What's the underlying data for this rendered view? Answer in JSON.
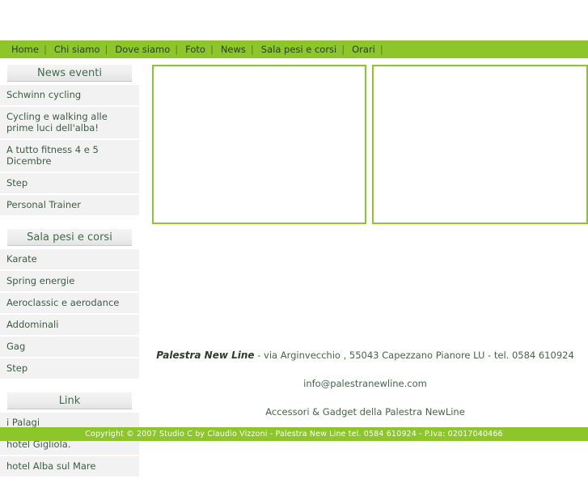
{
  "nav": {
    "separator": "|",
    "items": [
      {
        "label": "Home"
      },
      {
        "label": "Chi siamo"
      },
      {
        "label": "Dove siamo"
      },
      {
        "label": "Foto"
      },
      {
        "label": "News"
      },
      {
        "label": "Sala pesi e corsi"
      },
      {
        "label": "Orari"
      }
    ]
  },
  "sidebar": {
    "panels": [
      {
        "title": "News eventi",
        "items": [
          {
            "label": "Schwinn cycling"
          },
          {
            "label": "Cycling e walking alle prime luci dell'alba!"
          },
          {
            "label": "A tutto fitness 4 e 5 Dicembre"
          },
          {
            "label": "Step"
          },
          {
            "label": "Personal Trainer"
          }
        ]
      },
      {
        "title": "Sala pesi e corsi",
        "items": [
          {
            "label": "Karate"
          },
          {
            "label": "Spring energie"
          },
          {
            "label": "Aeroclassic e aerodance"
          },
          {
            "label": "Addominali"
          },
          {
            "label": "Gag"
          },
          {
            "label": "Step"
          }
        ]
      },
      {
        "title": "Link",
        "items": [
          {
            "label": "i Palagi"
          },
          {
            "label": "hotel Gigliola."
          },
          {
            "label": "hotel Alba sul Mare"
          }
        ]
      }
    ]
  },
  "main": {
    "media_boxes": [
      {
        "name": "media-placeholder-left"
      },
      {
        "name": "media-placeholder-right"
      }
    ],
    "contact": {
      "business_name": "Palestra New Line",
      "address_line": " - via Arginvecchio , 55043 Capezzano Pianore LU - tel. 0584 610924",
      "email": "info@palestranewline.com",
      "tagline": "Accessori & Gadget della Palestra NewLine"
    }
  },
  "footer": {
    "copyright": "Copyright © 2007 Studio C by Claudio Vizzoni - Palestra New Line tel. 0584 610924 - P.Iva: 02017040466"
  },
  "colors": {
    "brand_green": "#8cc62a",
    "text_green": "#3d5c42",
    "header_text_green": "#3e6b4a",
    "panel_gray": "#f2f2f2"
  }
}
